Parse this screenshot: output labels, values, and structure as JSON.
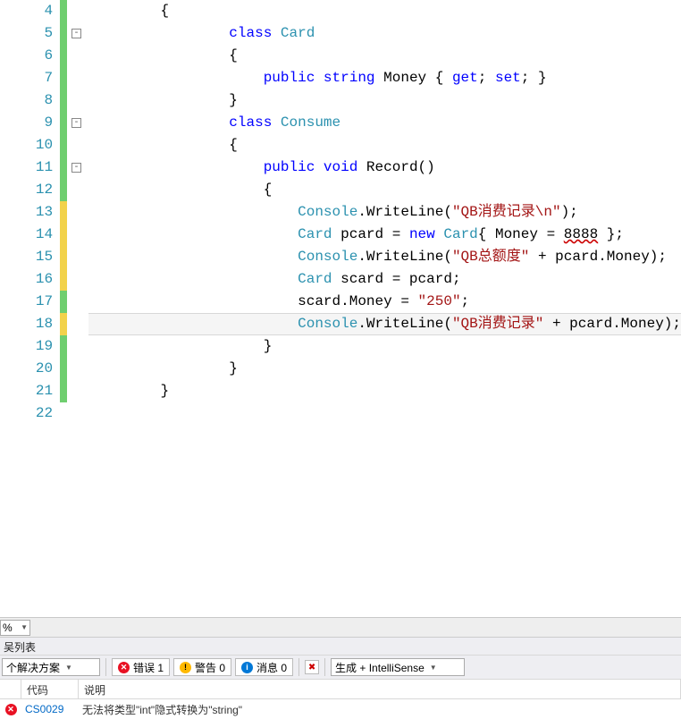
{
  "lines": [
    {
      "n": 4,
      "bar": "green",
      "fold": "",
      "html": "{",
      "indent": 2
    },
    {
      "n": 5,
      "bar": "green",
      "fold": "minus",
      "html": "<span class='kw'>class</span> <span class='typ'>Card</span>",
      "indent": 4
    },
    {
      "n": 6,
      "bar": "green",
      "fold": "",
      "html": "{",
      "indent": 4
    },
    {
      "n": 7,
      "bar": "green",
      "fold": "",
      "html": "<span class='kw'>public</span> <span class='kw'>string</span> Money { <span class='kw'>get</span>; <span class='kw'>set</span>; }",
      "indent": 5
    },
    {
      "n": 8,
      "bar": "green",
      "fold": "",
      "html": "}",
      "indent": 4
    },
    {
      "n": 9,
      "bar": "green",
      "fold": "minus",
      "html": "<span class='kw'>class</span> <span class='typ'>Consume</span>",
      "indent": 4
    },
    {
      "n": 10,
      "bar": "green",
      "fold": "",
      "html": "{",
      "indent": 4
    },
    {
      "n": 11,
      "bar": "green",
      "fold": "minus",
      "html": "<span class='kw'>public</span> <span class='kw'>void</span> Record()",
      "indent": 5
    },
    {
      "n": 12,
      "bar": "green",
      "fold": "",
      "html": "{",
      "indent": 5
    },
    {
      "n": 13,
      "bar": "yellow",
      "fold": "",
      "html": "<span class='typ'>Console</span>.WriteLine(<span class='str'>\"QB消费记录\\n\"</span>);",
      "indent": 6
    },
    {
      "n": 14,
      "bar": "yellow",
      "fold": "",
      "html": "<span class='typ'>Card</span> pcard = <span class='kw'>new</span> <span class='typ'>Card</span>{ Money = <span class='squiggle'>8888</span> };",
      "indent": 6
    },
    {
      "n": 15,
      "bar": "yellow",
      "fold": "",
      "html": "<span class='typ'>Console</span>.WriteLine(<span class='str'>\"QB总额度\"</span> + pcard.Money);",
      "indent": 6
    },
    {
      "n": 16,
      "bar": "yellow",
      "fold": "",
      "html": "<span class='typ'>Card</span> scard = pcard;",
      "indent": 6
    },
    {
      "n": 17,
      "bar": "green",
      "fold": "",
      "html": "scard.Money = <span class='str'>\"250\"</span>;",
      "indent": 6
    },
    {
      "n": 18,
      "bar": "yellow",
      "fold": "",
      "html": "<span class='typ'>Console</span>.WriteLine(<span class='str'>\"QB消费记录\"</span> + pcard.Money);",
      "indent": 6,
      "current": true
    },
    {
      "n": 19,
      "bar": "green",
      "fold": "",
      "html": "}",
      "indent": 5
    },
    {
      "n": 20,
      "bar": "green",
      "fold": "",
      "html": "}",
      "indent": 4
    },
    {
      "n": 21,
      "bar": "green",
      "fold": "",
      "html": "}",
      "indent": 2
    },
    {
      "n": 22,
      "bar": "",
      "fold": "",
      "html": "",
      "indent": 0
    }
  ],
  "zoom": {
    "value": "%"
  },
  "panel": {
    "title": "吴列表"
  },
  "toolbar": {
    "scope": "个解决方案",
    "errors_label": "错误 1",
    "warnings_label": "警告 0",
    "messages_label": "消息 0",
    "filter_combo": "生成 + IntelliSense"
  },
  "grid": {
    "headers": {
      "icon": "",
      "code": "代码",
      "desc": "说明"
    },
    "rows": [
      {
        "code": "CS0029",
        "desc": "无法将类型\"int\"隐式转换为\"string\""
      }
    ]
  }
}
